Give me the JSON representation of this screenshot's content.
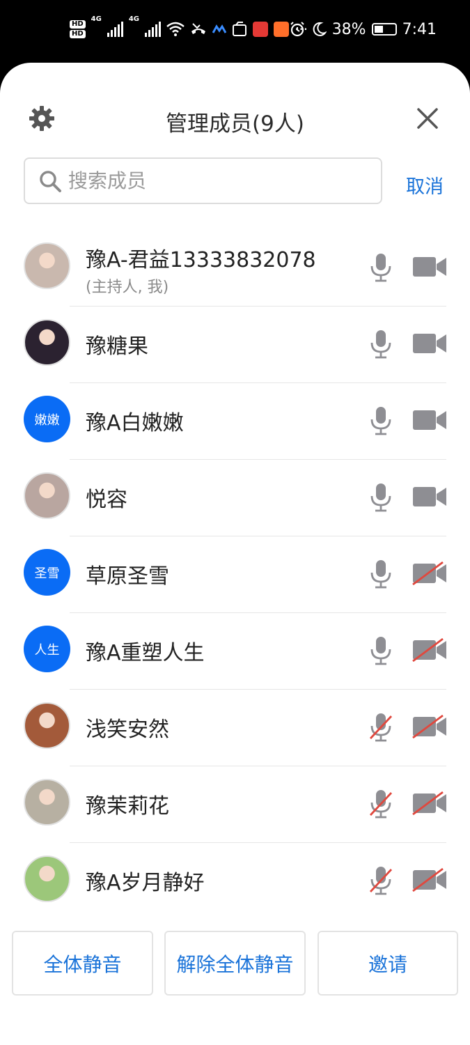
{
  "status_bar": {
    "network_label": "4G",
    "battery": "38%",
    "time": "7:41",
    "icons": [
      "hd-icon",
      "signal-icon",
      "wifi-icon",
      "missed-call-icon",
      "app-icon",
      "app-icon",
      "record-icon",
      "app-icon",
      "more-icon",
      "alarm-icon",
      "moon-icon",
      "battery-icon"
    ]
  },
  "header": {
    "title": "管理成员(9人)",
    "settings_icon": "gear-icon",
    "close_icon": "close-icon"
  },
  "search": {
    "placeholder": "搜索成员",
    "cancel_label": "取消"
  },
  "members": [
    {
      "name": "豫A-君益13333832078",
      "sub": "(主持人, 我)",
      "avatar_text": "",
      "avatar_color": "#c9b8ae",
      "mic_muted": false,
      "cam_off": false
    },
    {
      "name": "豫糖果",
      "sub": "",
      "avatar_text": "",
      "avatar_color": "#2b2230",
      "mic_muted": false,
      "cam_off": false
    },
    {
      "name": "豫A白嫩嫩",
      "sub": "",
      "avatar_text": "嫩嫩",
      "avatar_color": "#0a6cf5",
      "mic_muted": false,
      "cam_off": false
    },
    {
      "name": "悦容",
      "sub": "",
      "avatar_text": "",
      "avatar_color": "#b9a6a0",
      "mic_muted": false,
      "cam_off": false
    },
    {
      "name": "草原圣雪",
      "sub": "",
      "avatar_text": "圣雪",
      "avatar_color": "#0a6cf5",
      "mic_muted": false,
      "cam_off": true
    },
    {
      "name": "豫A重塑人生",
      "sub": "",
      "avatar_text": "人生",
      "avatar_color": "#0a6cf5",
      "mic_muted": false,
      "cam_off": true
    },
    {
      "name": "浅笑安然",
      "sub": "",
      "avatar_text": "",
      "avatar_color": "#a35a3a",
      "mic_muted": true,
      "cam_off": true
    },
    {
      "name": "豫茉莉花",
      "sub": "",
      "avatar_text": "",
      "avatar_color": "#b7b0a2",
      "mic_muted": true,
      "cam_off": true
    },
    {
      "name": "豫A岁月静好",
      "sub": "",
      "avatar_text": "",
      "avatar_color": "#9cc77a",
      "mic_muted": true,
      "cam_off": true
    }
  ],
  "footer": {
    "mute_all": "全体静音",
    "unmute_all": "解除全体静音",
    "invite": "邀请"
  },
  "colors": {
    "accent": "#1a73d9",
    "avatar_blue": "#0a6cf5",
    "icon_gray": "#8e8e93",
    "muted_red": "#e0483e"
  }
}
